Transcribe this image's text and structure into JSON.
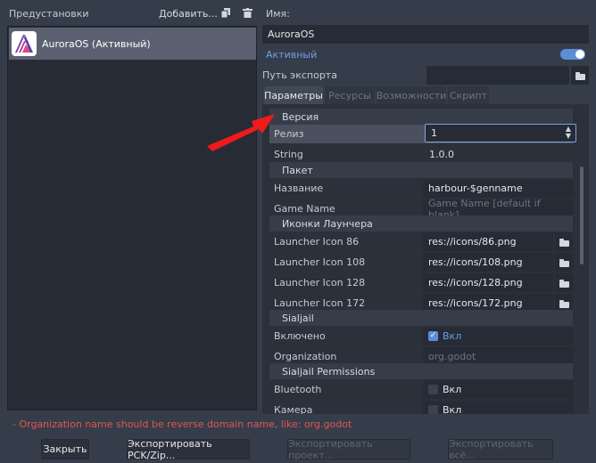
{
  "presets": {
    "header": "Предустановки",
    "add_label": "Добавить...",
    "items": [
      {
        "label": "AuroraOS (Активный)"
      }
    ]
  },
  "editor": {
    "name_label": "Имя:",
    "name_value": "AuroraOS",
    "runnable_label": "Активный",
    "runnable_on": true,
    "export_path_label": "Путь экспорта",
    "export_path_value": ""
  },
  "tabs": [
    {
      "label": "Параметры",
      "active": true
    },
    {
      "label": "Ресурсы",
      "active": false
    },
    {
      "label": "Возможности",
      "active": false
    },
    {
      "label": "Скрипт",
      "active": false
    }
  ],
  "sections": {
    "version": "Версия",
    "package": "Пакет",
    "launcher_icons": "Иконки Лаунчера",
    "sailjail": "Sialjail",
    "sailjail_permissions": "Sialjail Permissions"
  },
  "props": {
    "release_label": "Релиз",
    "release_value": "1",
    "string_label": "String",
    "string_value": "1.0.0",
    "name_label": "Название",
    "name_value": "harbour-$genname",
    "game_name_label": "Game Name",
    "game_name_placeholder": "Game Name [default if blank]",
    "icons": [
      {
        "label": "Launcher Icon 86",
        "value": "res://icons/86.png"
      },
      {
        "label": "Launcher Icon 108",
        "value": "res://icons/108.png"
      },
      {
        "label": "Launcher Icon 128",
        "value": "res://icons/128.png"
      },
      {
        "label": "Launcher Icon 172",
        "value": "res://icons/172.png"
      }
    ],
    "enabled_label": "Включено",
    "enabled_value": "Вкл",
    "enabled_checked": true,
    "organization_label": "Organization",
    "organization_placeholder": "org.godot",
    "bluetooth_label": "Bluetooth",
    "bluetooth_value": "Вкл",
    "camera_label": "Камера",
    "camera_value": "Вкл"
  },
  "error_text": "- Organization name should be reverse domain name, like: org.godot",
  "buttons": {
    "close": "Закрыть",
    "export_pck": "Экспортировать PCK/Zip...",
    "export_project": "Экспортировать проект...",
    "export_all": "Экспортировать всё..."
  },
  "colors": {
    "accent": "#5a8fd8",
    "error": "#e3564e",
    "annotation_arrow": "#f01a1a"
  }
}
